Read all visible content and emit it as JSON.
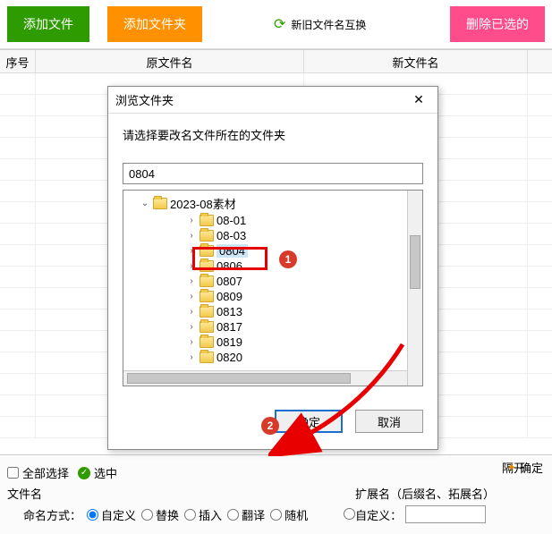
{
  "toolbar": {
    "add_file": "添加文件",
    "add_folder": "添加文件夹",
    "swap_names": "新旧文件名互换",
    "delete_selected": "删除已选的"
  },
  "grid": {
    "col_seq": "序号",
    "col_old": "原文件名",
    "col_new": "新文件名"
  },
  "dialog": {
    "title": "浏览文件夹",
    "instruction": "请选择要改名文件所在的文件夹",
    "path_value": "0804",
    "root": "2023-08素材",
    "items": [
      "08-01",
      "08-03",
      "0804",
      "0806",
      "0807",
      "0809",
      "0813",
      "0817",
      "0819",
      "0820"
    ],
    "selected_index": 2,
    "ok": "确定",
    "cancel": "取消"
  },
  "bottom": {
    "select_all": "全部选择",
    "select_in": "选中",
    "filename_label": "文件名",
    "naming_label": "命名方式：",
    "radios": [
      "自定义",
      "替换",
      "插入",
      "翻译",
      "随机"
    ],
    "ext_label": "扩展名（后缀名、拓展名）",
    "ext_custom": "自定义：",
    "sep_label": "隔开",
    "confirm": "确定"
  },
  "annot": {
    "b1": "1",
    "b2": "2"
  }
}
